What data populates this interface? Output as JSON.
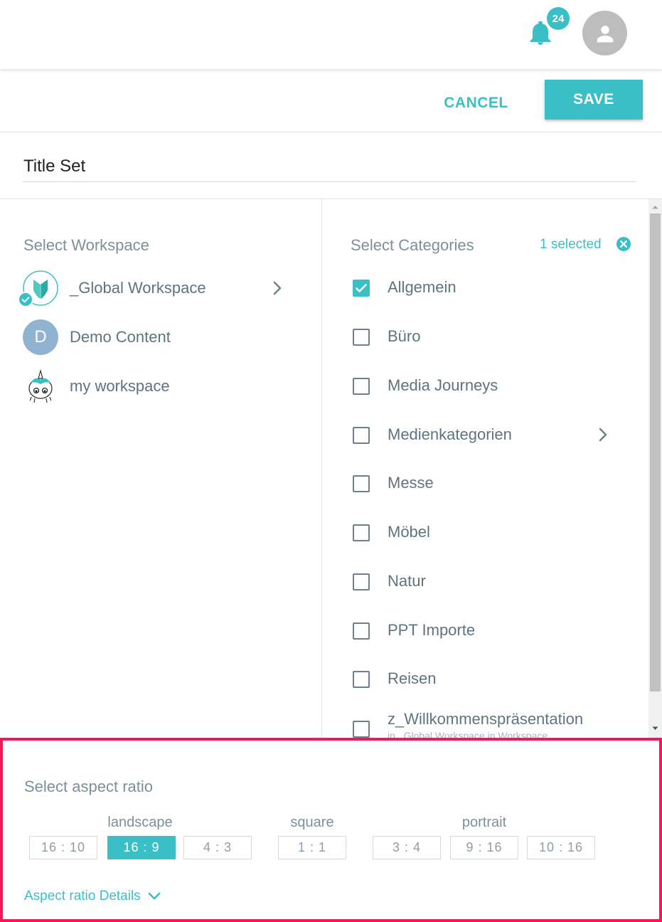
{
  "header": {
    "notifications_count": "24",
    "bell_icon": "bell-icon",
    "avatar_icon": "person-icon"
  },
  "actions": {
    "cancel_label": "CANCEL",
    "save_label": "SAVE"
  },
  "title_input": {
    "value": "Title Set"
  },
  "workspaces": {
    "heading": "Select Workspace",
    "items": [
      {
        "label": "_Global Workspace",
        "avatar": "leaf-logo-icon",
        "verified": true,
        "has_children": true
      },
      {
        "label": "Demo Content",
        "avatar_letter": "D",
        "avatar_color": "#8fb3d1"
      },
      {
        "label": "my workspace",
        "avatar": "unicorn-icon"
      }
    ]
  },
  "categories": {
    "heading": "Select Categories",
    "selected_label": "1 selected",
    "items": [
      {
        "label": "Allgemein",
        "checked": true
      },
      {
        "label": "Büro",
        "checked": false
      },
      {
        "label": "Media Journeys",
        "checked": false
      },
      {
        "label": "Medienkategorien",
        "checked": false,
        "has_children": true
      },
      {
        "label": "Messe",
        "checked": false
      },
      {
        "label": "Möbel",
        "checked": false
      },
      {
        "label": "Natur",
        "checked": false
      },
      {
        "label": "PPT Importe",
        "checked": false
      },
      {
        "label": "Reisen",
        "checked": false
      },
      {
        "label": "z_Willkommenspräsentation",
        "sublabel": "in _Global Workspace in Workspace",
        "checked": false
      }
    ]
  },
  "aspect_ratio": {
    "heading": "Select aspect ratio",
    "groups": [
      {
        "label": "landscape",
        "ratios": [
          "16 : 10",
          "16 : 9",
          "4 : 3"
        ]
      },
      {
        "label": "square",
        "ratios": [
          "1 : 1"
        ]
      },
      {
        "label": "portrait",
        "ratios": [
          "3 : 4",
          "9 : 16",
          "10 : 16"
        ]
      }
    ],
    "selected": "16 : 9",
    "details_label": "Aspect ratio Details"
  },
  "colors": {
    "accent": "#3abfc7",
    "highlight_border": "#fb1457",
    "text": "#5f7480"
  }
}
